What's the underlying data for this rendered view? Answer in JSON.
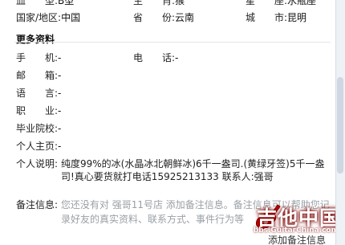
{
  "top": {
    "blood_label": "血　　型:",
    "blood_value": "B型",
    "zodiac_label": "生　　肖:",
    "zodiac_value": "猴",
    "star_label": "星　　座:",
    "star_value": "水瓶座",
    "country_label": "国家/地区:",
    "country_value": "中国",
    "province_label": "省　　份:",
    "province_value": "云南",
    "city_label": "城　　市:",
    "city_value": "昆明"
  },
  "more": {
    "title": "更多资料",
    "rows": [
      {
        "label": "手　　机:",
        "value": "-"
      },
      {
        "label": "邮　　箱:",
        "value": "-"
      },
      {
        "label": "语　　言:",
        "value": "-"
      },
      {
        "label": "职　　业:",
        "value": "-"
      },
      {
        "label": "毕业院校:",
        "value": "-"
      },
      {
        "label": "个人主页:",
        "value": "-"
      }
    ],
    "phone_label": "电　　话:",
    "phone_value": "-",
    "desc_label": "个人说明:",
    "desc_line1": "纯度99%的冰(水晶冰北朝鲜冰)6千一盎司.(黄绿牙签)5千一盎",
    "desc_line2": "司!真心要货就打电话15925213133 联系人:强哥"
  },
  "note": {
    "label": "备注信息:",
    "text_line1": "您还没有对 强哥11号店 添加备注信息。备注信息可以帮助您记",
    "text_line2": "录好友的真实资料、联系方式、事件行为等",
    "add_button": "添加备注信息"
  },
  "watermark": {
    "main": "吉他中国",
    "url": "bbs.GuitarChina.com"
  }
}
